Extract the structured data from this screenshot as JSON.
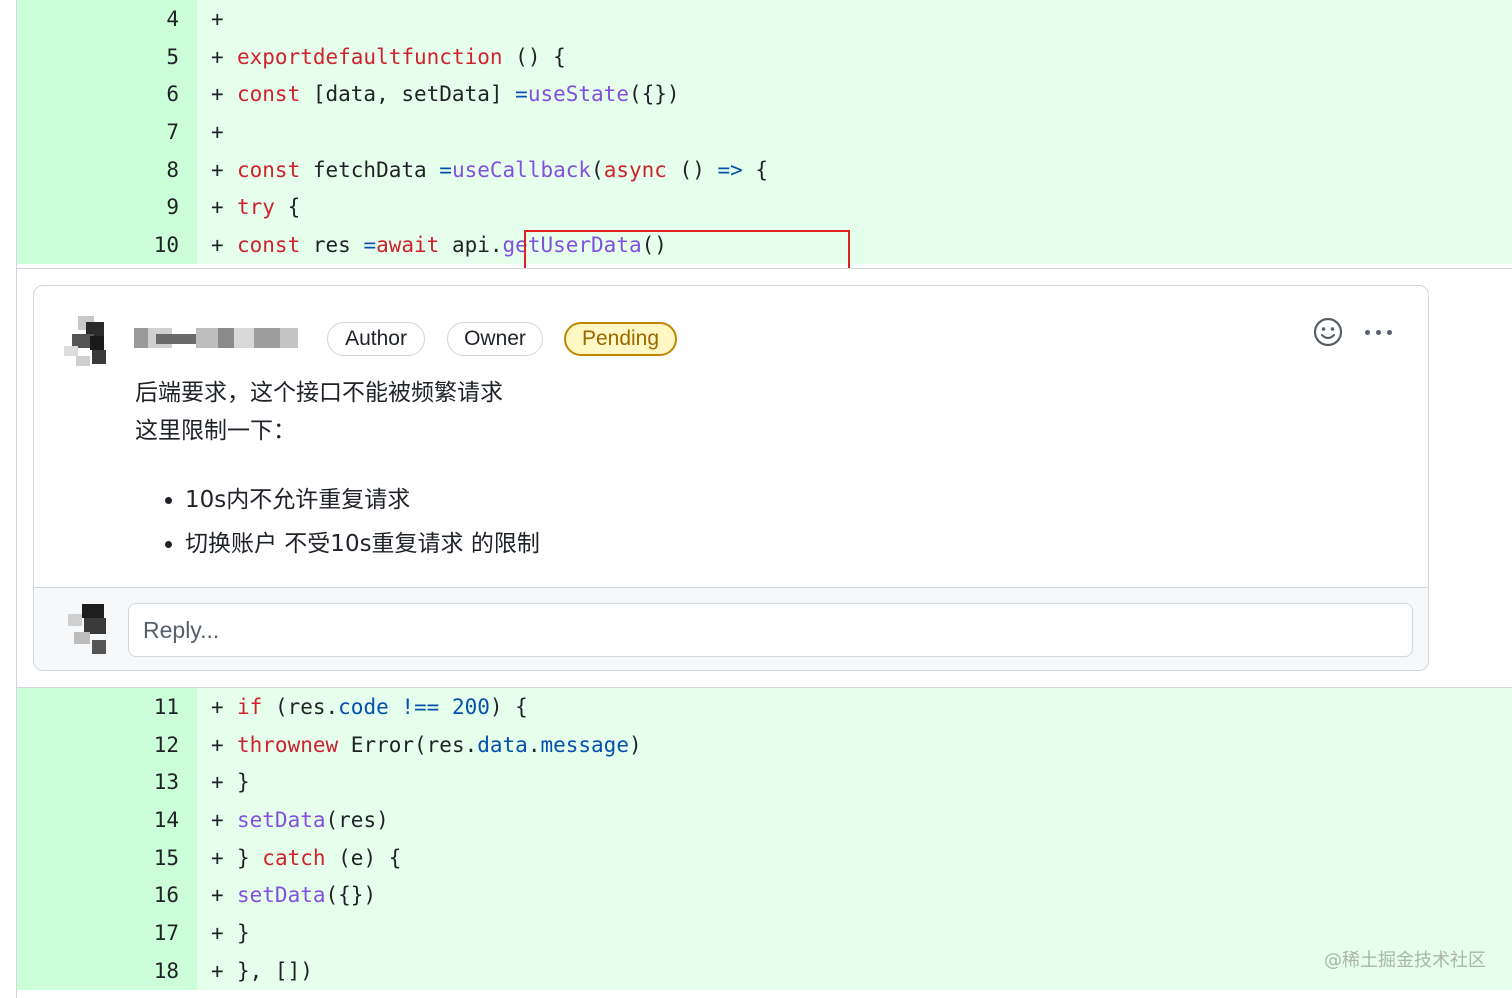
{
  "diff": {
    "top_lines": [
      {
        "num": "4",
        "plus": "+"
      },
      {
        "num": "5",
        "plus": "+"
      },
      {
        "num": "6",
        "plus": "+"
      },
      {
        "num": "7",
        "plus": "+"
      },
      {
        "num": "8",
        "plus": "+"
      },
      {
        "num": "9",
        "plus": "+"
      },
      {
        "num": "10",
        "plus": "+"
      }
    ],
    "bottom_lines": [
      {
        "num": "11",
        "plus": "+"
      },
      {
        "num": "12",
        "plus": "+"
      },
      {
        "num": "13",
        "plus": "+"
      },
      {
        "num": "14",
        "plus": "+"
      },
      {
        "num": "15",
        "plus": "+"
      },
      {
        "num": "16",
        "plus": "+"
      },
      {
        "num": "17",
        "plus": "+"
      },
      {
        "num": "18",
        "plus": "+"
      }
    ],
    "tokens": {
      "export": "export",
      "default": "default",
      "function": "function",
      "fn_tail": " () {",
      "const": "const",
      "destructure": " [data, setData] ",
      "eq": "=",
      "useState": "useState",
      "useState_args": "({})",
      "fetchData": " fetchData ",
      "useCallback": "useCallback",
      "paren_open": "(",
      "async": "async",
      "arrow_pre": " () ",
      "arrow": "=>",
      "brace": " {",
      "try": "try",
      "res_decl": " res ",
      "await": "await",
      "api": " api.",
      "getUserData": "getUserData",
      "call_tail": "()",
      "if": "if",
      "res_open": " (res.",
      "code": "code",
      "neq": " !==",
      "n200": " 200",
      "if_tail": ") {",
      "throw": "throw",
      "new": "new",
      "error_open": " Error(res.",
      "data": "data",
      "dot": ".",
      "message": "message",
      "close_paren": ")",
      "close_brace": "}",
      "setData": "setData",
      "res_arg": "(res)",
      "catch_pre": "} ",
      "catch": "catch",
      "catch_tail": " (e) {",
      "empty_obj_arg": "({})",
      "end_callback": "}, [])"
    }
  },
  "comment": {
    "badges": {
      "author": "Author",
      "owner": "Owner",
      "pending": "Pending"
    },
    "body_line1": "后端要求，这个接口不能被频繁请求",
    "body_line2": "这里限制一下：",
    "bullets": [
      "10s内不允许重复请求",
      "切换账户 不受10s重复请求 的限制"
    ],
    "reply_placeholder": "Reply..."
  },
  "watermark": "@稀土掘金技术社区",
  "colors": {
    "added_bg": "#e6ffec",
    "added_gutter": "#ccffd8",
    "keyword": "#cf222e",
    "function": "#8250df",
    "constant": "#0550ae",
    "highlight_box": "#e02020",
    "pending": "#bf8700"
  }
}
